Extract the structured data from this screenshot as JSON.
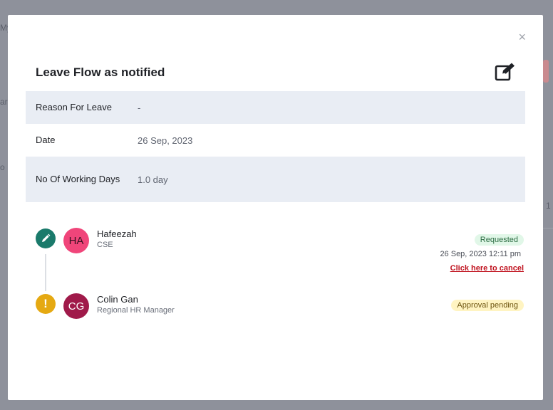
{
  "modal": {
    "title": "Leave Flow as notified",
    "close_label": "×"
  },
  "details": [
    {
      "label": "Reason For Leave",
      "value": "-"
    },
    {
      "label": "Date",
      "value": "26 Sep, 2023"
    },
    {
      "label": "No Of Working Days",
      "value": "1.0 day"
    }
  ],
  "flow": [
    {
      "status_icon": "pencil-icon",
      "initials": "HA",
      "name": "Hafeezah",
      "role": "CSE",
      "badge": "Requested",
      "timestamp": "26 Sep, 2023 12:11 pm",
      "action": "Click here to cancel"
    },
    {
      "status_icon": "exclamation-icon",
      "status_glyph": "!",
      "initials": "CG",
      "name": "Colin Gan",
      "role": "Regional HR Manager",
      "badge": "Approval pending"
    }
  ],
  "background": {
    "fragment_1": "My",
    "fragment_2": "ar",
    "fragment_3": "o",
    "fragment_4": "1"
  },
  "colors": {
    "accent_green": "#1a7a6b",
    "pending_yellow": "#e5a912",
    "cancel_red": "#c0131f"
  }
}
